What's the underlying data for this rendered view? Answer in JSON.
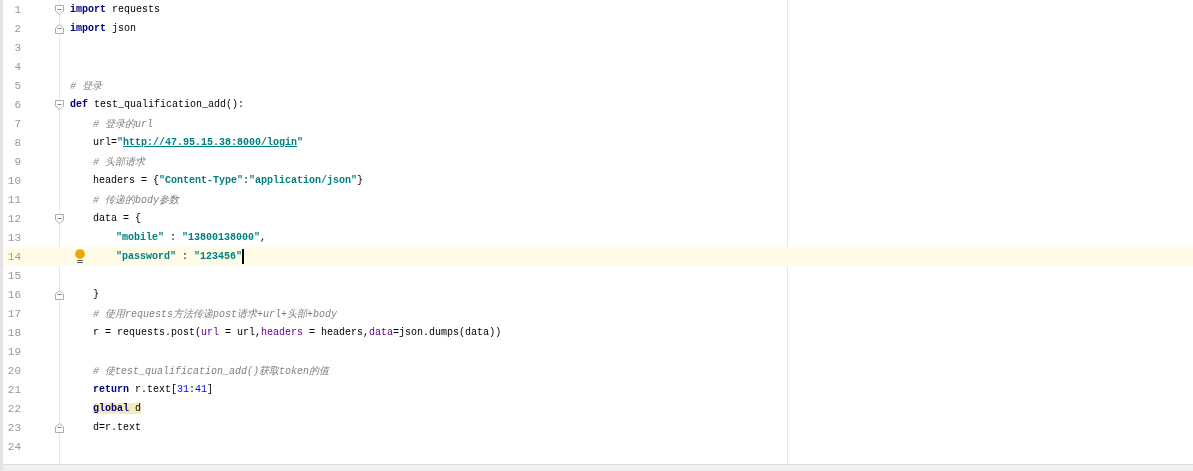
{
  "editor": {
    "lines": [
      {
        "number": "1",
        "fold_start": true,
        "tokens": [
          {
            "kind": "keyword",
            "text": "import"
          },
          {
            "kind": "plain",
            "text": " requests"
          }
        ]
      },
      {
        "number": "2",
        "fold_end": true,
        "tokens": [
          {
            "kind": "keyword",
            "text": "import"
          },
          {
            "kind": "plain",
            "text": " json"
          }
        ]
      },
      {
        "number": "3"
      },
      {
        "number": "4"
      },
      {
        "number": "5",
        "tokens": [
          {
            "kind": "comment",
            "text": "# 登录"
          }
        ]
      },
      {
        "number": "6",
        "fold_start": true,
        "tokens": [
          {
            "kind": "keyword",
            "text": "def"
          },
          {
            "kind": "plain",
            "text": " test_qualification_add():"
          }
        ],
        "children": [
          {
            "number": "7",
            "tokens": [
              {
                "kind": "comment",
                "text": "# 登录的url"
              }
            ]
          },
          {
            "number": "8",
            "tokens": [
              {
                "kind": "plain",
                "text": "url="
              },
              {
                "kind": "string",
                "text": "\""
              },
              {
                "kind": "link",
                "text": "http://47.95.15.38:8000/login"
              },
              {
                "kind": "string",
                "text": "\""
              }
            ]
          },
          {
            "number": "9",
            "tokens": [
              {
                "kind": "comment",
                "text": "# 头部请求"
              }
            ]
          },
          {
            "number": "10",
            "tokens": [
              {
                "kind": "plain",
                "text": "headers = {"
              },
              {
                "kind": "string",
                "text": "\"Content-Type\""
              },
              {
                "kind": "plain",
                "text": ":"
              },
              {
                "kind": "string",
                "text": "\"application/json\""
              },
              {
                "kind": "plain",
                "text": "}"
              }
            ]
          },
          {
            "number": "11",
            "tokens": [
              {
                "kind": "comment",
                "text": "# 传递的body参数"
              }
            ]
          },
          {
            "number": "12",
            "fold_start": true,
            "tokens": [
              {
                "kind": "plain",
                "text": "data = {"
              }
            ],
            "children": [
              {
                "number": "13",
                "tokens": [
                  {
                    "kind": "string",
                    "text": "\"mobile\""
                  },
                  {
                    "kind": "plain",
                    "text": " : "
                  },
                  {
                    "kind": "string",
                    "text": "\"13800138000\""
                  },
                  {
                    "kind": "plain",
                    "text": ","
                  }
                ]
              },
              {
                "number": "14",
                "current": true,
                "intention_bulb": true,
                "tokens": [
                  {
                    "kind": "string",
                    "text": "\"password\""
                  },
                  {
                    "kind": "plain",
                    "text": " : "
                  },
                  {
                    "kind": "string",
                    "text": "\"123456\""
                  }
                ]
              },
              {
                "number": "15"
              }
            ]
          },
          {
            "number": "16",
            "fold_end": true,
            "tokens": [
              {
                "kind": "plain",
                "text": "}"
              }
            ]
          },
          {
            "number": "17",
            "tokens": [
              {
                "kind": "comment",
                "text": "# 使用requests方法传递post请求+url+头部+body"
              }
            ]
          },
          {
            "number": "18",
            "tokens": [
              {
                "kind": "plain",
                "text": "r = requests.post("
              },
              {
                "kind": "param",
                "text": "url"
              },
              {
                "kind": "plain",
                "text": " = url,"
              },
              {
                "kind": "param",
                "text": "headers"
              },
              {
                "kind": "plain",
                "text": " = headers,"
              },
              {
                "kind": "param",
                "text": "data"
              },
              {
                "kind": "plain",
                "text": "=json.dumps(data))"
              }
            ]
          },
          {
            "number": "19"
          },
          {
            "number": "20",
            "tokens": [
              {
                "kind": "comment",
                "text": "# 使test_qualification_add()获取token的值"
              }
            ]
          },
          {
            "number": "21",
            "tokens": [
              {
                "kind": "keyword",
                "text": "return"
              },
              {
                "kind": "plain",
                "text": " r.text["
              },
              {
                "kind": "number",
                "text": "31"
              },
              {
                "kind": "plain",
                "text": ":"
              },
              {
                "kind": "number",
                "text": "41"
              },
              {
                "kind": "plain",
                "text": "]"
              }
            ]
          },
          {
            "number": "22",
            "tokens": [
              {
                "kind": "keyword",
                "text": "global",
                "marked": true
              },
              {
                "kind": "plain",
                "text": " d",
                "marked": true
              }
            ]
          },
          {
            "number": "23",
            "fold_end": true,
            "tokens": [
              {
                "kind": "plain",
                "text": "d=r.text"
              }
            ]
          }
        ]
      },
      {
        "number": "24"
      }
    ]
  }
}
